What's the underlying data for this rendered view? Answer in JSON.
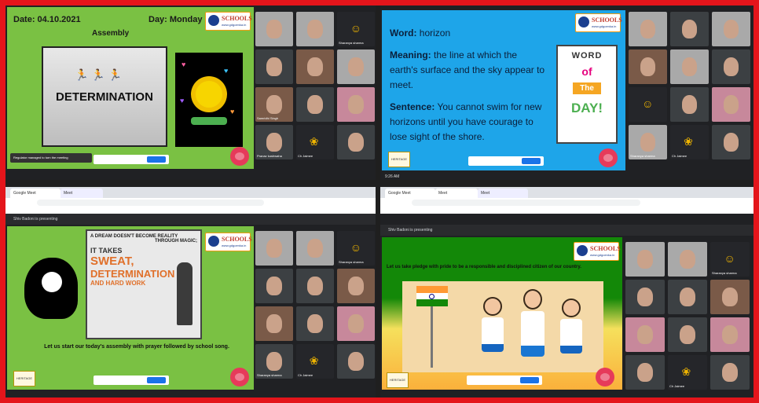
{
  "q1": {
    "date": "Date: 04.10.2021",
    "day": "Day: Monday",
    "heading": "Assembly",
    "banner_word": "DETERMINATION",
    "logo_text": "SCHOOLS",
    "logo_sub": "www.gdgoenka.in",
    "notification": "Regulator managed to turn the meeting",
    "tiles": [
      "",
      "",
      "Sharanya sharma",
      "",
      "",
      "",
      "Samridhi Singh",
      "",
      "",
      "Pranav kushwaha",
      "Ch Jaimee",
      ""
    ]
  },
  "q2": {
    "word_label": "Word:",
    "word_value": "horizon",
    "meaning_label": "Meaning:",
    "meaning_value": "the line at which the earth's surface and the sky appear to meet.",
    "sentence_label": "Sentence:",
    "sentence_value": "You cannot swim for new horizons until you have courage to lose sight of the shore.",
    "card_word": "WORD",
    "card_of": "of",
    "card_the": "The",
    "card_day": "DAY!",
    "time": "9:26 AM",
    "tiles": [
      "",
      "",
      "",
      "",
      "",
      "",
      "",
      "",
      "",
      "Sharanya sharma",
      "Ch Jaimee",
      ""
    ]
  },
  "q3": {
    "poster_line1": "A DREAM DOESN'T BECOME REALITY",
    "poster_line2": "THROUGH MAGIC;",
    "poster_line3": "IT TAKES",
    "poster_line4": "SWEAT,",
    "poster_line5": "DETERMINATION",
    "poster_line6": "AND HARD WORK",
    "caption": "Let us start our today's assembly with prayer followed by school song.",
    "presenter": "Shiv Badoni is presenting",
    "tiles": [
      "",
      "",
      "Sharanya sharma",
      "",
      "",
      "",
      "",
      "",
      "",
      "Sharanya sharma",
      "Ch Jaimee",
      ""
    ]
  },
  "q4": {
    "pledge": "Let us take pledge with pride to be a responsible and disciplined citizen of our country.",
    "presenter": "Shiv Badoni is presenting",
    "tiles": [
      "",
      "",
      "Sharanya sharma",
      "",
      "",
      "",
      "",
      "",
      "",
      "",
      "Ch Jaimee",
      ""
    ]
  },
  "colors": {
    "border": "#e4151b",
    "green_slide": "#7ac143",
    "blue_slide": "#1ea5e9",
    "flag_saffron": "#ff9933",
    "flag_green": "#138808"
  }
}
